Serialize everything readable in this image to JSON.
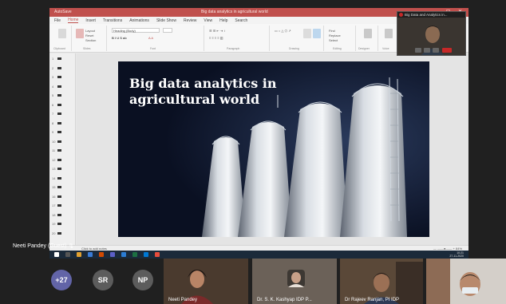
{
  "app": {
    "window_title": "Big data analytics in agricultural world",
    "quick_access": "AutoSave",
    "window_controls": "— ▢ ✕"
  },
  "menu": [
    "File",
    "Home",
    "Insert",
    "Transitions",
    "Animations",
    "Slide Show",
    "Review",
    "View",
    "Help",
    "Search"
  ],
  "ribbon": {
    "groups": [
      "Clipboard",
      "Slides",
      "Font",
      "Paragraph",
      "Drawing",
      "Editing",
      "Designer",
      "Voice",
      "Add-ins"
    ],
    "font_box": "Heading (Body)",
    "buttons": [
      "New Slide",
      "Layout",
      "Reset",
      "Section",
      "Arrange",
      "Quick Styles",
      "Find",
      "Replace",
      "Select",
      "Dictate",
      "Design Ideas"
    ]
  },
  "thumbnails": [
    "1",
    "2",
    "3",
    "4",
    "5",
    "6",
    "7",
    "8",
    "9",
    "10",
    "11",
    "12",
    "13",
    "14",
    "15",
    "16",
    "17",
    "18",
    "19",
    "20"
  ],
  "slide": {
    "title_line1": "Big data analytics in",
    "title_line2": "agricultural world"
  },
  "status": {
    "notes": "Click to add notes",
    "zoom": "—  ——●——  +  84%"
  },
  "clock": {
    "time": "10:21",
    "date": "27-11-2020"
  },
  "pip": {
    "title": "Big Data and Analytics in..."
  },
  "presenter": {
    "name": "Neeti Pandey (Guest)"
  },
  "participants": {
    "overflow": "+27",
    "initials": [
      {
        "label": "SR",
        "color": "#5c5c5c"
      },
      {
        "label": "NP",
        "color": "#5c5c5c"
      }
    ],
    "tiles": [
      {
        "name": "Neeti Pandey"
      },
      {
        "name": "Dr. S. K. Kashyap IDP P..."
      },
      {
        "name": "Dr Rajeev Ranjan, PI IDP"
      },
      {
        "name": ""
      }
    ]
  },
  "colors": {
    "accent": "#c0504d",
    "overflow_circle": "#6264a7",
    "slide_bg": "#0a1022"
  },
  "icons": [
    "mic-icon",
    "camera-icon",
    "hangup-icon",
    "record-icon"
  ]
}
